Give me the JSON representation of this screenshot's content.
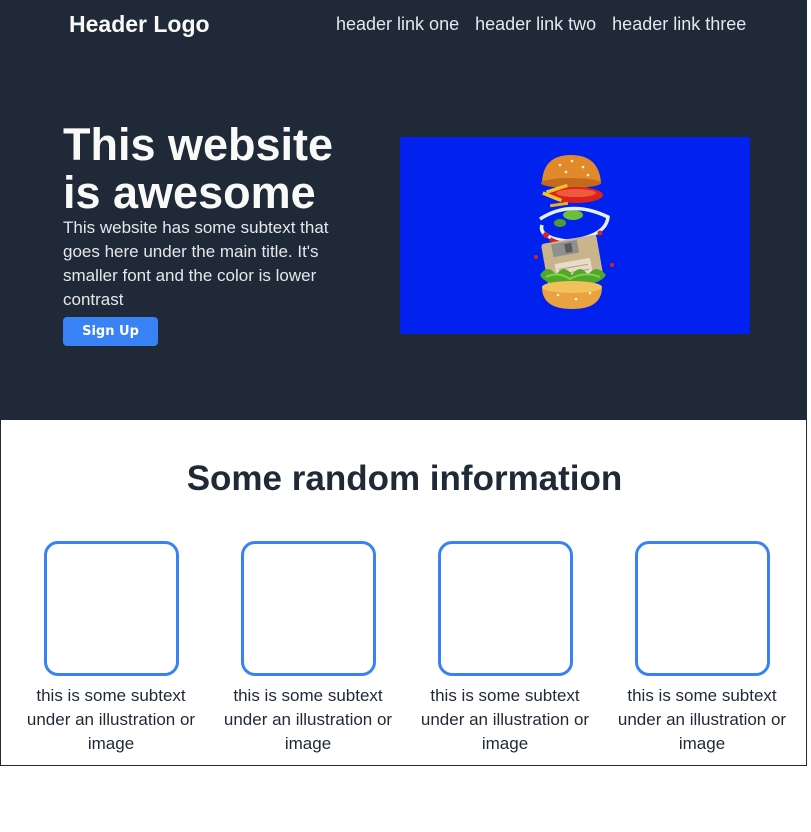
{
  "header": {
    "logo": "Header Logo",
    "links": [
      "header link one",
      "header link two",
      "header link three"
    ]
  },
  "hero": {
    "title": "This website is awesome",
    "subtext": "This website has some subtext that goes here under the main title. It's smaller font and the color is lower contrast",
    "button_label": "Sign Up",
    "image_icon": "burger-icon"
  },
  "info": {
    "title": "Some random information",
    "cards": [
      {
        "text": "this is some subtext under an illustration or image"
      },
      {
        "text": "this is some subtext under an illustration or image"
      },
      {
        "text": "this is some subtext under an illustration or image"
      },
      {
        "text": "this is some subtext under an illustration or image"
      }
    ]
  },
  "colors": {
    "hero_bg": "#1f2937",
    "accent": "#3882f6",
    "image_bg": "#0021ee",
    "text_light": "#f9faf8",
    "text_muted": "#e5e7eb"
  }
}
